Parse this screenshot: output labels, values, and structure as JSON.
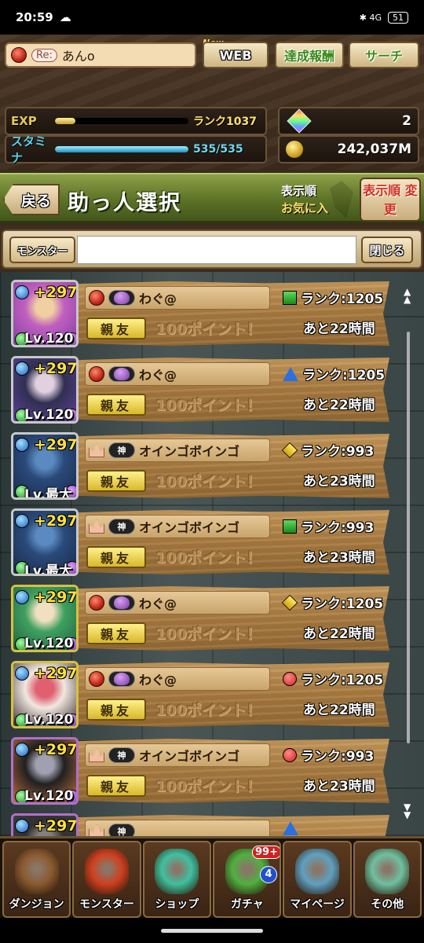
{
  "statusbar": {
    "time": "20:59",
    "cloud": "☁",
    "icons": "✱ 4G",
    "battery": "51"
  },
  "header": {
    "player_name": "あんo",
    "re_label": "Re:",
    "new_label": "New",
    "web_label": "WEB",
    "rewards_label": "達成報酬",
    "search_label": "サーチ"
  },
  "stats": {
    "exp_label": "EXP",
    "rank_text": "ランク1037",
    "exp_fill_fraction": 0.15,
    "stamina_label": "スタミナ",
    "stamina_text": "535/535",
    "stamina_fill_fraction": 1.0,
    "magic_stones": "2",
    "coins": "242,037M"
  },
  "titlebar": {
    "back_label": "戻る",
    "title": "助っ人選択",
    "sort_label": "表示順",
    "sort_value": "お気に入",
    "sort_change_label": "表示順 変更"
  },
  "filter": {
    "monster_label": "モンスター",
    "search_value": "",
    "close_label": "閉じる"
  },
  "helpers": [
    {
      "name": "わぐ@",
      "badge": "slime",
      "rank": "ランク:1205",
      "rank_icon": "square",
      "time": "あと22時間",
      "plus": "+297",
      "level": "Lv.120",
      "friend": "親友",
      "points": "100ポイント！",
      "frame": "silver",
      "art": [
        "#c060c0",
        "#f0d0a0",
        "#8040a0"
      ]
    },
    {
      "name": "わぐ@",
      "badge": "slime",
      "rank": "ランク:1205",
      "rank_icon": "triangle",
      "time": "あと22時間",
      "plus": "+297",
      "level": "Lv.120",
      "friend": "親友",
      "points": "100ポイント！",
      "frame": "silver",
      "art": [
        "#303050",
        "#e0d0e0",
        "#6040a0"
      ]
    },
    {
      "name": "オインゴボインゴ",
      "badge": "神",
      "rank": "ランク:993",
      "rank_icon": "diamond",
      "time": "あと23時間",
      "plus": "+297",
      "level": "Lv.最大",
      "friend": "親友",
      "points": "100ポイント！",
      "frame": "silver",
      "art": [
        "#2a4a7a",
        "#5a8ac0",
        "#1a2a4a"
      ]
    },
    {
      "name": "オインゴボインゴ",
      "badge": "神",
      "rank": "ランク:993",
      "rank_icon": "square",
      "time": "あと23時間",
      "plus": "+297",
      "level": "Lv.最大",
      "friend": "親友",
      "points": "100ポイント！",
      "frame": "silver",
      "art": [
        "#2a4a7a",
        "#5a8ac0",
        "#1a2a4a"
      ]
    },
    {
      "name": "わぐ@",
      "badge": "slime",
      "rank": "ランク:1205",
      "rank_icon": "diamond",
      "time": "あと22時間",
      "plus": "+297",
      "level": "Lv.120",
      "friend": "親友",
      "points": "100ポイント！",
      "frame": "gold",
      "art": [
        "#40a060",
        "#f0e0c0",
        "#206040"
      ]
    },
    {
      "name": "わぐ@",
      "badge": "slime",
      "rank": "ランク:1205",
      "rank_icon": "circle",
      "time": "あと22時間",
      "plus": "+297",
      "level": "Lv.120",
      "friend": "親友",
      "points": "100ポイント！",
      "frame": "gold",
      "art": [
        "#f0e8e0",
        "#e06070",
        "#3a2a2a"
      ]
    },
    {
      "name": "オインゴボインゴ",
      "badge": "神",
      "rank": "ランク:993",
      "rank_icon": "circle",
      "time": "あと23時間",
      "plus": "+297",
      "level": "Lv.120",
      "friend": "親友",
      "points": "100ポイント！",
      "frame": "purple",
      "art": [
        "#202020",
        "#a0a0b0",
        "#c07040"
      ]
    },
    {
      "name": "",
      "badge": "神",
      "rank": "",
      "rank_icon": "triangle",
      "time": "",
      "plus": "+297",
      "level": "",
      "friend": "",
      "points": "",
      "frame": "purple",
      "art": [
        "#303030",
        "#808080",
        "#404040"
      ]
    }
  ],
  "nav": [
    {
      "label": "ダンジョン",
      "icon": "dungeon-icon",
      "color": "#8a5a30"
    },
    {
      "label": "モンスター",
      "icon": "monster-icon",
      "color": "#d04020"
    },
    {
      "label": "ショップ",
      "icon": "shop-icon",
      "color": "#40c0a0"
    },
    {
      "label": "ガチャ",
      "icon": "gacha-icon",
      "color": "#50b040",
      "badge_count": "99+",
      "badge_sub": "4"
    },
    {
      "label": "マイページ",
      "icon": "mypage-icon",
      "color": "#60a0c0"
    },
    {
      "label": "その他",
      "icon": "other-icon",
      "color": "#70c0a0"
    }
  ],
  "colors": {
    "accent_gold": "#ffe040",
    "header_green": "#5c7226",
    "wood": "#a87a40"
  }
}
